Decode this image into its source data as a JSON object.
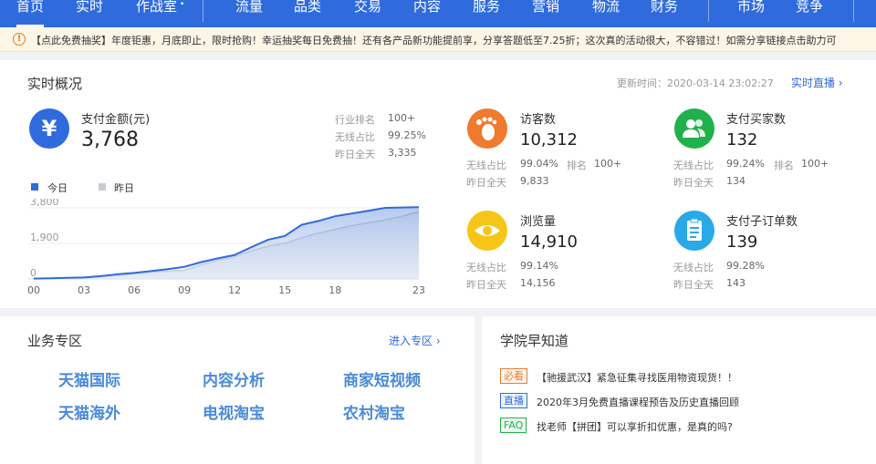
{
  "nav": {
    "items": [
      "首页",
      "实时",
      "作战室",
      "流量",
      "品类",
      "交易",
      "内容",
      "服务",
      "营销",
      "物流",
      "财务",
      "市场",
      "竞争"
    ],
    "active": "首页"
  },
  "notice": {
    "icon": "!",
    "text": "【点此免费抽奖】年度钜惠，月底即止，限时抢购！幸运抽奖每日免费抽！还有各产品新功能提前享，分享答题低至7.25折；这次真的活动很大，不容错过！如需分享链接点击助力可"
  },
  "realtime": {
    "title": "实时概况",
    "update_time": "更新时间：2020-03-14 23:02:27",
    "live_link": "实时直播 ›",
    "payment": {
      "icon_glyph": "¥",
      "label": "支付金额(元)",
      "value": "3,768",
      "stats": [
        {
          "k": "行业排名",
          "v": "100+"
        },
        {
          "k": "无线占比",
          "v": "99.25%"
        },
        {
          "k": "昨日全天",
          "v": "3,335"
        }
      ]
    },
    "legend": {
      "today": "今日",
      "yesterday": "昨日"
    },
    "metrics": [
      {
        "key": "visitors",
        "label": "访客数",
        "value": "10,312",
        "color": "#f07a2d",
        "mobile_k": "无线占比",
        "mobile_v": "99.04%",
        "rank_k": "排名",
        "rank_v": "100+",
        "yday_k": "昨日全天",
        "yday_v": "9,833"
      },
      {
        "key": "buyers",
        "label": "支付买家数",
        "value": "132",
        "color": "#20b14c",
        "mobile_k": "无线占比",
        "mobile_v": "99.24%",
        "rank_k": "排名",
        "rank_v": "100+",
        "yday_k": "昨日全天",
        "yday_v": "134"
      },
      {
        "key": "pageviews",
        "label": "浏览量",
        "value": "14,910",
        "color": "#f5c518",
        "mobile_k": "无线占比",
        "mobile_v": "99.14%",
        "yday_k": "昨日全天",
        "yday_v": "14,156"
      },
      {
        "key": "suborders",
        "label": "支付子订单数",
        "value": "139",
        "color": "#2aa9e8",
        "mobile_k": "无线占比",
        "mobile_v": "99.28%",
        "yday_k": "昨日全天",
        "yday_v": "143"
      }
    ]
  },
  "chart_data": {
    "type": "area",
    "x": [
      "00",
      "03",
      "06",
      "09",
      "12",
      "15",
      "18",
      "23"
    ],
    "y_ticks": [
      "3,800",
      "1,900",
      "0"
    ],
    "ylim": [
      0,
      3800
    ],
    "xlim": [
      0,
      23
    ],
    "series": [
      {
        "name": "今日",
        "color": "#2f6bdc",
        "points": [
          [
            0,
            20
          ],
          [
            1,
            40
          ],
          [
            2,
            60
          ],
          [
            3,
            80
          ],
          [
            4,
            150
          ],
          [
            5,
            250
          ],
          [
            6,
            320
          ],
          [
            7,
            420
          ],
          [
            8,
            520
          ],
          [
            9,
            650
          ],
          [
            10,
            900
          ],
          [
            11,
            1100
          ],
          [
            12,
            1280
          ],
          [
            13,
            1700
          ],
          [
            14,
            2100
          ],
          [
            15,
            2300
          ],
          [
            16,
            2900
          ],
          [
            17,
            3100
          ],
          [
            18,
            3350
          ],
          [
            19,
            3500
          ],
          [
            20,
            3650
          ],
          [
            21,
            3800
          ],
          [
            22,
            3820
          ],
          [
            23,
            3840
          ]
        ]
      },
      {
        "name": "昨日",
        "color": "#c8ccd4",
        "points": [
          [
            0,
            10
          ],
          [
            1,
            30
          ],
          [
            2,
            50
          ],
          [
            3,
            70
          ],
          [
            4,
            120
          ],
          [
            5,
            200
          ],
          [
            6,
            280
          ],
          [
            7,
            360
          ],
          [
            8,
            420
          ],
          [
            9,
            460
          ],
          [
            10,
            760
          ],
          [
            11,
            1000
          ],
          [
            12,
            1200
          ],
          [
            13,
            1500
          ],
          [
            14,
            1750
          ],
          [
            15,
            1900
          ],
          [
            16,
            2200
          ],
          [
            17,
            2450
          ],
          [
            18,
            2650
          ],
          [
            19,
            2850
          ],
          [
            20,
            3000
          ],
          [
            21,
            3150
          ],
          [
            22,
            3350
          ],
          [
            23,
            3600
          ]
        ]
      }
    ]
  },
  "business": {
    "title": "业务专区",
    "enter_link": "进入专区 ›",
    "links": [
      "天猫国际",
      "内容分析",
      "商家短视频",
      "天猫海外",
      "电视淘宝",
      "农村淘宝"
    ]
  },
  "academy": {
    "title": "学院早知道",
    "items": [
      {
        "badge": "必看",
        "badge_color": "#f07a2d",
        "text": "【驰援武汉】紧急征集寻找医用物资现货！！"
      },
      {
        "badge": "直播",
        "badge_color": "#2f6bdc",
        "text": "2020年3月免费直播课程预告及历史直播回顾"
      },
      {
        "badge": "FAQ",
        "badge_color": "#20b14c",
        "text": "找老师【拼团】可以享折扣优惠，是真的吗?"
      }
    ]
  }
}
